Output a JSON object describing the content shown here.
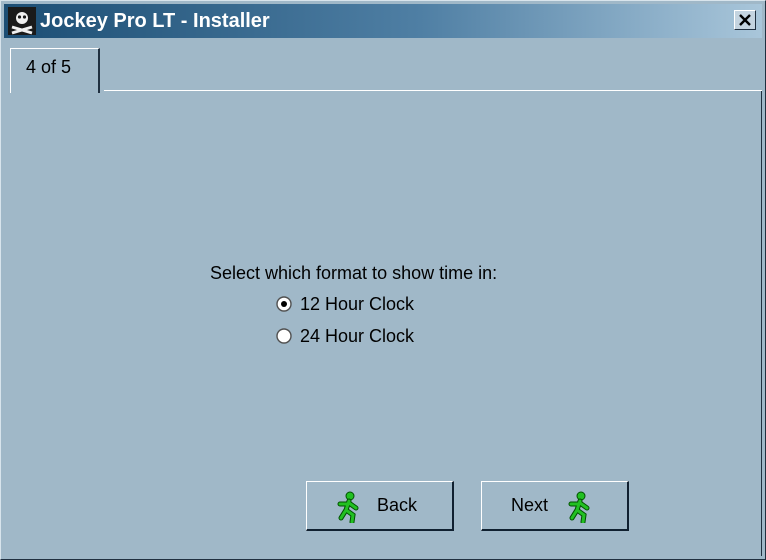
{
  "window": {
    "title": "Jockey Pro LT - Installer"
  },
  "tabs": [
    {
      "label": "4 of 5"
    }
  ],
  "step": {
    "prompt": "Select which format to show time in:",
    "options": [
      {
        "label": "12 Hour Clock",
        "selected": true
      },
      {
        "label": "24 Hour Clock",
        "selected": false
      }
    ]
  },
  "buttons": {
    "back": "Back",
    "next": "Next"
  },
  "icons": {
    "app": "pirate-flag-icon",
    "close": "close-icon",
    "back": "running-man-icon",
    "next": "running-man-icon"
  }
}
